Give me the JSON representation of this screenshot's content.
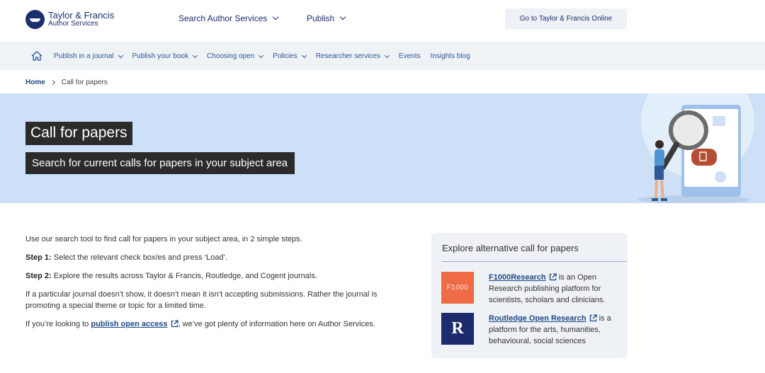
{
  "header": {
    "logo_title": "Taylor & Francis",
    "logo_subtitle": "Author Services",
    "nav": [
      {
        "label": "Search Author Services"
      },
      {
        "label": "Publish"
      }
    ],
    "online_button": "Go to Taylor & Francis Online"
  },
  "subnav": {
    "items": [
      {
        "label": "Publish in a journal",
        "dropdown": true
      },
      {
        "label": "Publish your book",
        "dropdown": true
      },
      {
        "label": "Choosing open",
        "dropdown": true
      },
      {
        "label": "Policies",
        "dropdown": true
      },
      {
        "label": "Researcher services",
        "dropdown": true
      },
      {
        "label": "Events",
        "dropdown": false
      },
      {
        "label": "Insights blog",
        "dropdown": false
      }
    ]
  },
  "breadcrumb": {
    "home": "Home",
    "current": "Call for papers"
  },
  "hero": {
    "title": "Call for papers",
    "subtitle": "Search for current calls for papers in your subject area"
  },
  "content": {
    "intro": "Use our search tool to find call for papers in your subject area, in 2 simple steps.",
    "step1_label": "Step 1:",
    "step1_text": " Select the relevant check box/es and press ‘Load’.",
    "step2_label": "Step 2:",
    "step2_text": " Explore the results across Taylor & Francis, Routledge, and Cogent journals.",
    "note": "If a particular journal doesn’t show, it doesn’t mean it isn’t accepting submissions. Rather the journal is promoting a special theme or topic for a limited time.",
    "oa_prefix": "If you’re looking to ",
    "oa_link": "publish open access",
    "oa_suffix": ", we’ve got plenty of information here on Author Services."
  },
  "sidebar": {
    "title": "Explore alternative call for papers",
    "items": [
      {
        "logo_text": "F1000",
        "link": "F1000Research",
        "text": " is an Open Research publishing platform for scientists, scholars and clinicians."
      },
      {
        "logo_text": "R",
        "link": "Routledge Open Research",
        "text": " is a platform for the arts, humanities, behavioural, social sciences"
      }
    ]
  },
  "colors": {
    "brand_navy": "#1d2e6e",
    "link_blue": "#1d4a84",
    "hero_bg": "#cde0f7",
    "f1000_orange": "#ef6b45"
  }
}
